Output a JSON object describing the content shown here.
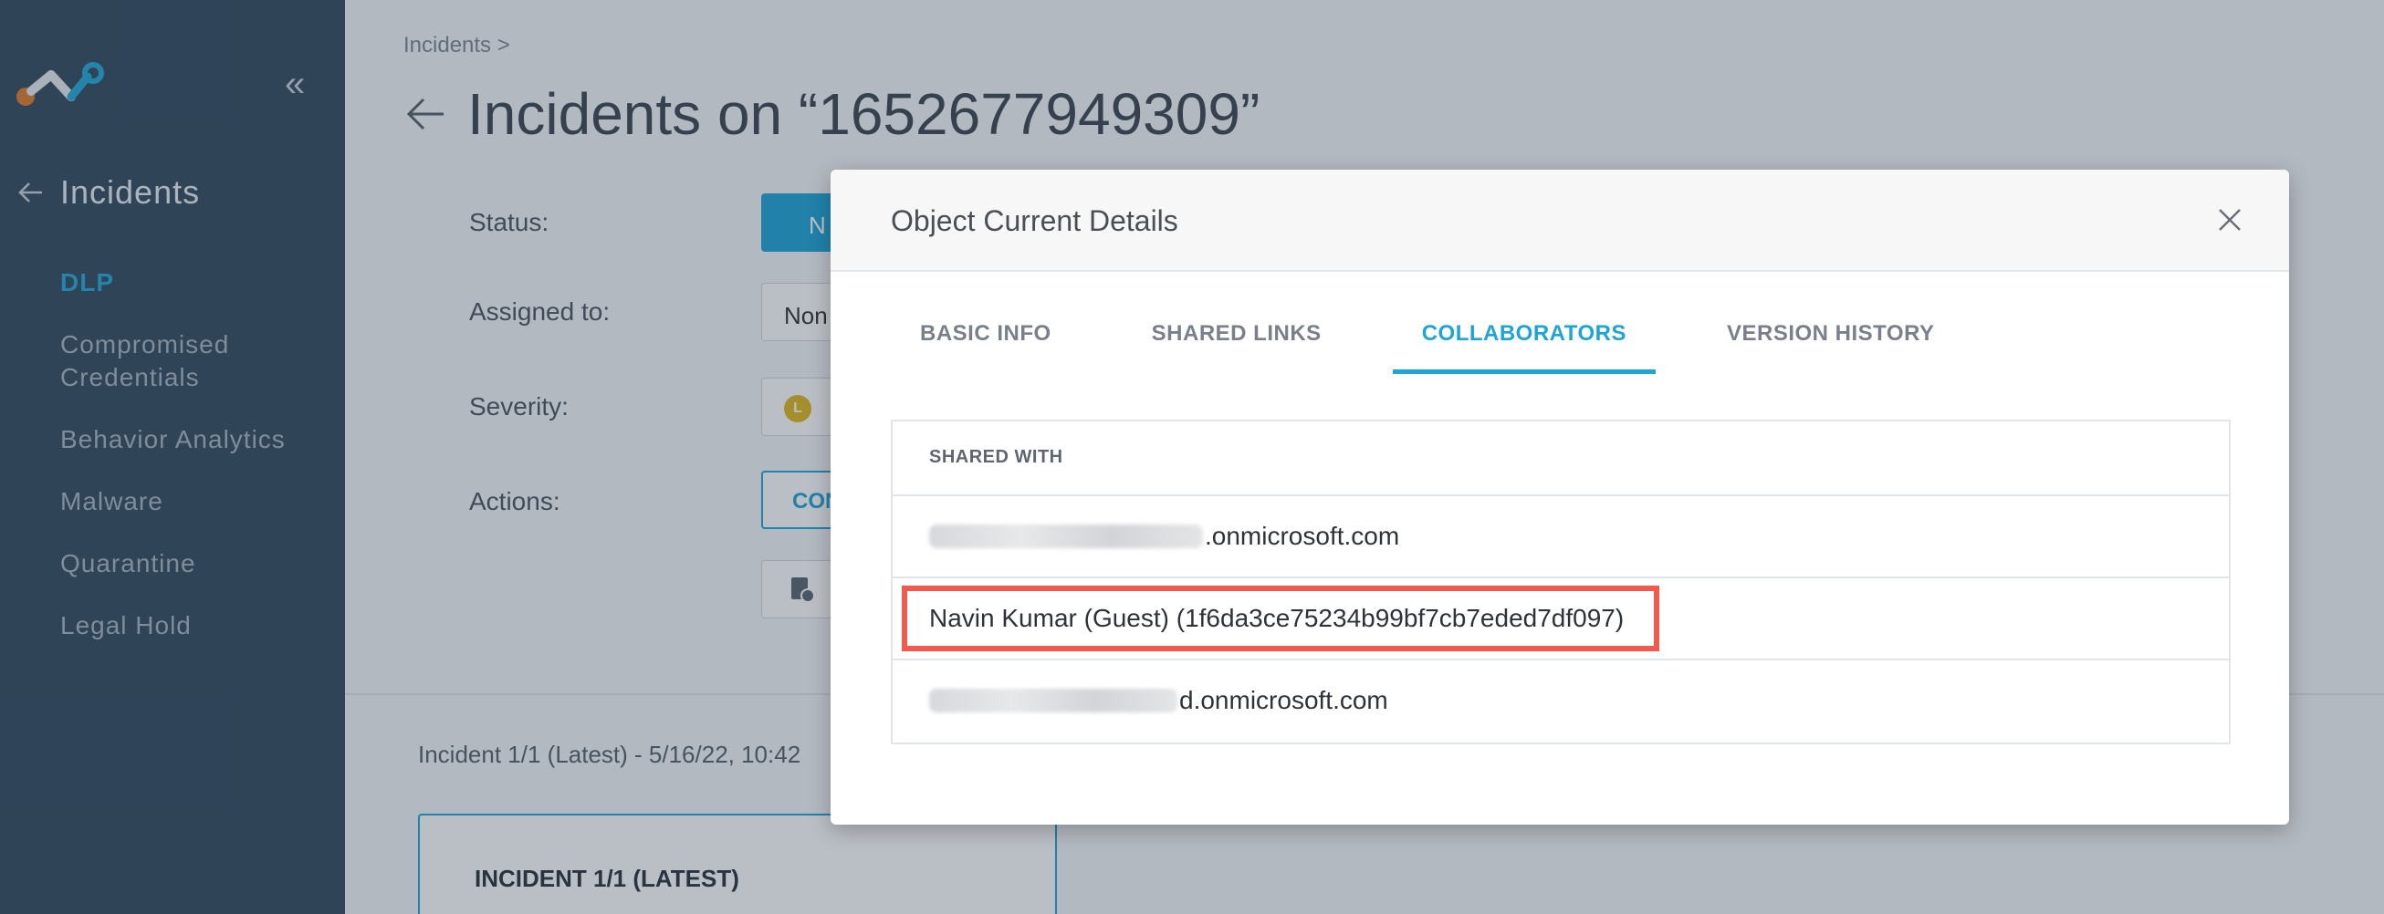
{
  "sidebar": {
    "back_title": "Incidents",
    "items": [
      {
        "label": "DLP",
        "active": true
      },
      {
        "label": "Compromised Credentials",
        "active": false
      },
      {
        "label": "Behavior Analytics",
        "active": false
      },
      {
        "label": "Malware",
        "active": false
      },
      {
        "label": "Quarantine",
        "active": false
      },
      {
        "label": "Legal Hold",
        "active": false
      }
    ]
  },
  "header": {
    "breadcrumb": "Incidents >",
    "title": "Incidents on “1652677949309”"
  },
  "form": {
    "status_label": "Status:",
    "status_value": "N",
    "assigned_label": "Assigned to:",
    "assigned_value": "Non",
    "severity_label": "Severity:",
    "severity_badge": "L",
    "actions_label": "Actions:",
    "actions_button": "CON"
  },
  "incident": {
    "meta": "Incident 1/1 (Latest) - 5/16/22, 10:42",
    "card_title": "INCIDENT 1/1 (LATEST)"
  },
  "modal": {
    "title": "Object Current Details",
    "tabs": [
      {
        "label": "BASIC INFO",
        "active": false
      },
      {
        "label": "SHARED LINKS",
        "active": false
      },
      {
        "label": "COLLABORATORS",
        "active": true
      },
      {
        "label": "VERSION HISTORY",
        "active": false
      }
    ],
    "table": {
      "header": "SHARED WITH",
      "rows": [
        {
          "visible_text": ".onmicrosoft.com"
        },
        {
          "visible_text": "Navin Kumar (Guest) (1f6da3ce75234b99bf7cb7eded7df097)"
        },
        {
          "visible_text": "d.onmicrosoft.com"
        }
      ]
    }
  },
  "colors": {
    "accent": "#1ea4d6",
    "sidebar_bg": "#334a5e",
    "highlight": "#f05a4f"
  }
}
